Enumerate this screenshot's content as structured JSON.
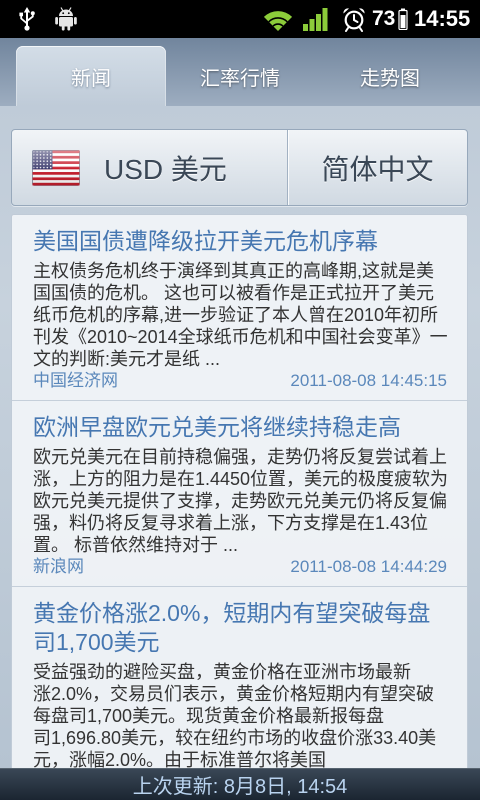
{
  "status_bar": {
    "battery_level": "73",
    "time": "14:55",
    "icons": {
      "usb": "usb-icon",
      "debug": "android-icon",
      "wifi": "wifi-icon",
      "signal": "signal-icon",
      "alarm": "alarm-clock-icon",
      "battery": "battery-icon"
    }
  },
  "tabs": [
    {
      "label": "新闻",
      "selected": true
    },
    {
      "label": "汇率行情",
      "selected": false
    },
    {
      "label": "走势图",
      "selected": false
    }
  ],
  "selector": {
    "flag_icon": "us-flag-icon",
    "currency": "USD 美元",
    "language": "简体中文"
  },
  "news": [
    {
      "title_lines": [
        "美国国债遭降级拉开美元危机序幕"
      ],
      "body_lines": [
        "主权债务危机终于演绎到其真正的高峰期,这就是美",
        "国国债的危机。 这也可以被看作是正式拉开了美元",
        "纸币危机的序幕,进一步验证了本人曾在2010年初所",
        "刊发《2010~2014全球纸币危机和中国社会变革》一",
        "文的判断:美元才是纸 ..."
      ],
      "source": "中国经济网",
      "date": "2011-08-08 14:45:15"
    },
    {
      "title_lines": [
        "欧洲早盘欧元兑美元将继续持稳走高"
      ],
      "body_lines": [
        "欧元兑美元在目前持稳偏强，走势仍将反复尝试着上",
        "涨，上方的阻力是在1.4450位置，美元的极度疲软为",
        "欧元兑美元提供了支撑，走势欧元兑美元仍将反复偏",
        "强，料仍将反复寻求着上涨，下方支撑是在1.43位",
        "置。 标普依然维持对于 ..."
      ],
      "source": "新浪网",
      "date": "2011-08-08 14:44:29"
    },
    {
      "title_lines": [
        "黄金价格涨2.0%，短期内有望突破每盘",
        "司1,700美元"
      ],
      "body_lines": [
        "受益强劲的避险买盘，黄金价格在亚洲市场最新",
        "涨2.0%，交易员们表示，黄金价格短期内有望突破",
        "每盘司1,700美元。现货黄金价格最新报每盘",
        "司1,696.80美元，较在纽约市场的收盘价涨33.40美",
        "元，涨幅2.0%。由于标准普尔将美国"
      ]
    }
  ],
  "footer": {
    "last_updated": "上次更新: 8月8日, 14:54"
  },
  "colors": {
    "title": "#4677b1",
    "meta": "#5b88bb",
    "body_text": "#333333",
    "footer_text": "#b9d3ef",
    "status_green": "#8ccc3a"
  }
}
